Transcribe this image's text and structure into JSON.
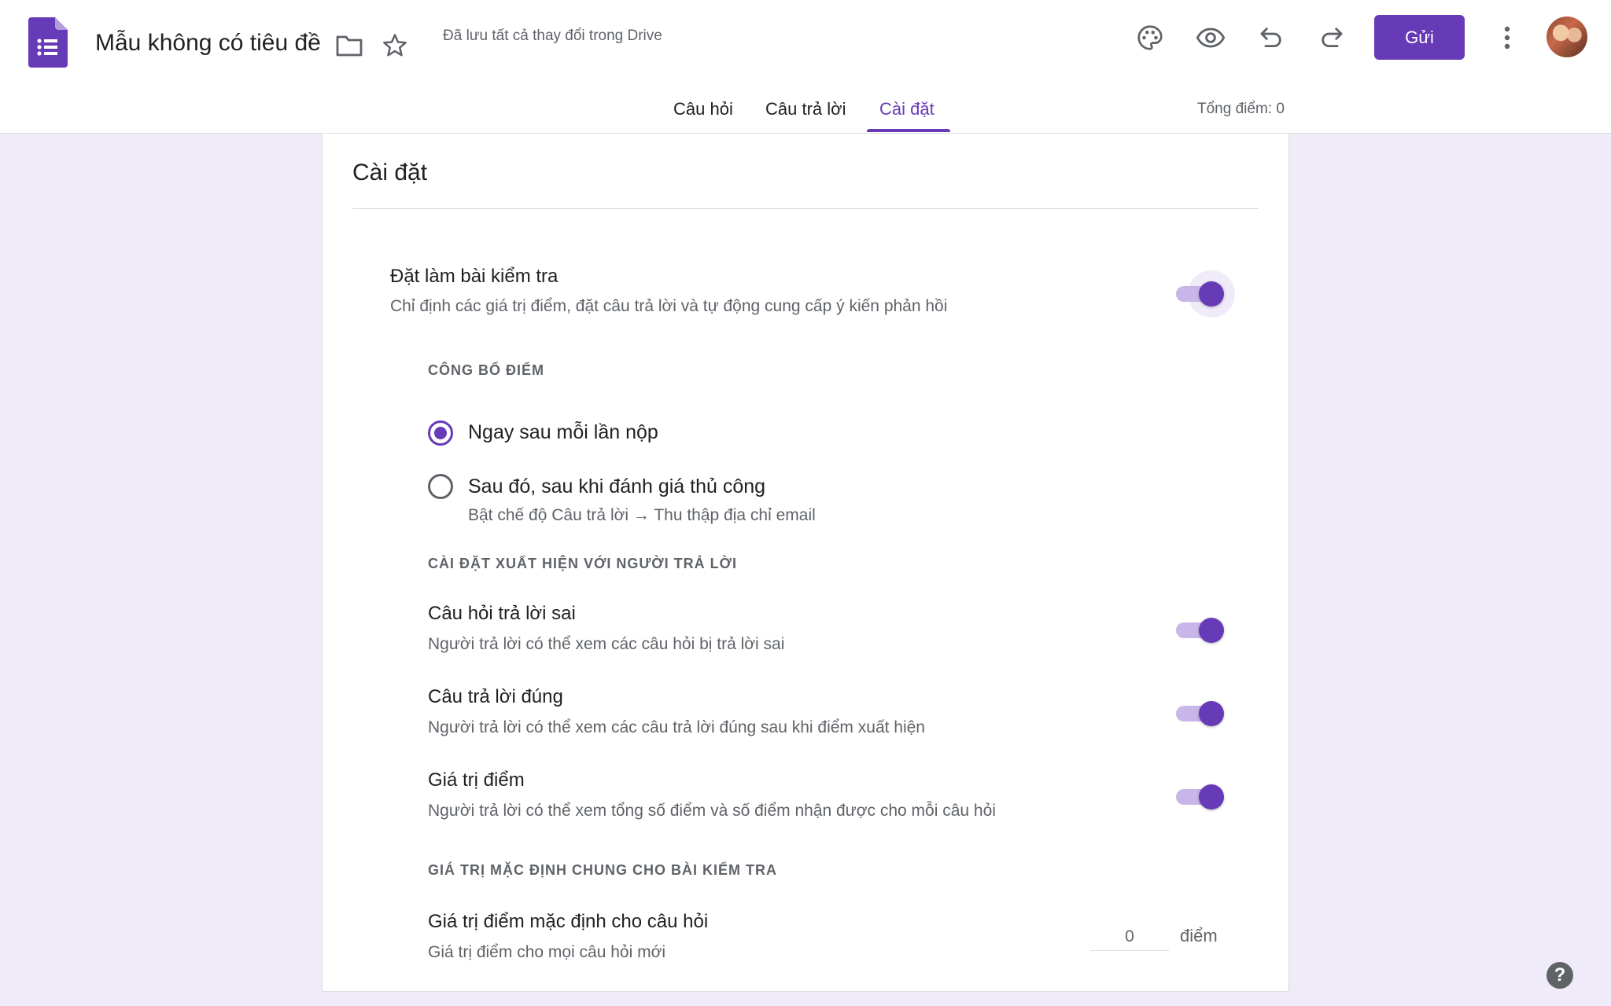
{
  "header": {
    "title": "Mẫu không có tiêu đề",
    "save_status": "Đã lưu tất cả thay đổi trong Drive",
    "send_label": "Gửi"
  },
  "tabs": [
    {
      "label": "Câu hỏi",
      "active": false
    },
    {
      "label": "Câu trả lời",
      "active": false
    },
    {
      "label": "Cài đặt",
      "active": true
    }
  ],
  "total_points": "Tổng điểm: 0",
  "settings": {
    "title": "Cài đặt",
    "quiz": {
      "title": "Đặt làm bài kiểm tra",
      "desc": "Chỉ định các giá trị điểm, đặt câu trả lời và tự động cung cấp ý kiến phản hồi",
      "enabled": true
    },
    "release_grade": {
      "label": "CÔNG BỐ ĐIỂM",
      "options": [
        {
          "label": "Ngay sau mỗi lần nộp",
          "checked": true
        },
        {
          "label": "Sau đó, sau khi đánh giá thủ công",
          "desc": "Bật chế độ Câu trả lời → Thu thập địa chỉ email",
          "checked": false
        }
      ]
    },
    "respondent": {
      "label": "CÀI ĐẶT XUẤT HIỆN VỚI NGƯỜI TRẢ LỜI",
      "items": [
        {
          "title": "Câu hỏi trả lời sai",
          "desc": "Người trả lời có thể xem các câu hỏi bị trả lời sai",
          "enabled": true
        },
        {
          "title": "Câu trả lời đúng",
          "desc": "Người trả lời có thể xem các câu trả lời đúng sau khi điểm xuất hiện",
          "enabled": true
        },
        {
          "title": "Giá trị điểm",
          "desc": "Người trả lời có thể xem tổng số điểm và số điểm nhận được cho mỗi câu hỏi",
          "enabled": true
        }
      ]
    },
    "defaults": {
      "label": "GIÁ TRỊ MẶC ĐỊNH CHUNG CHO BÀI KIỂM TRA",
      "point_value_title": "Giá trị điểm mặc định cho câu hỏi",
      "point_value_desc": "Giá trị điểm cho mọi câu hỏi mới",
      "point_value": "0",
      "unit": "điểm"
    }
  },
  "help": "?",
  "colors": {
    "accent": "#673ab7",
    "background": "#f0ebf8",
    "toggle_track": "#c9b6e8"
  },
  "icons": [
    "forms-logo-icon",
    "folder-icon",
    "star-icon",
    "palette-icon",
    "eye-icon",
    "undo-icon",
    "redo-icon",
    "more-vert-icon",
    "help-icon"
  ]
}
